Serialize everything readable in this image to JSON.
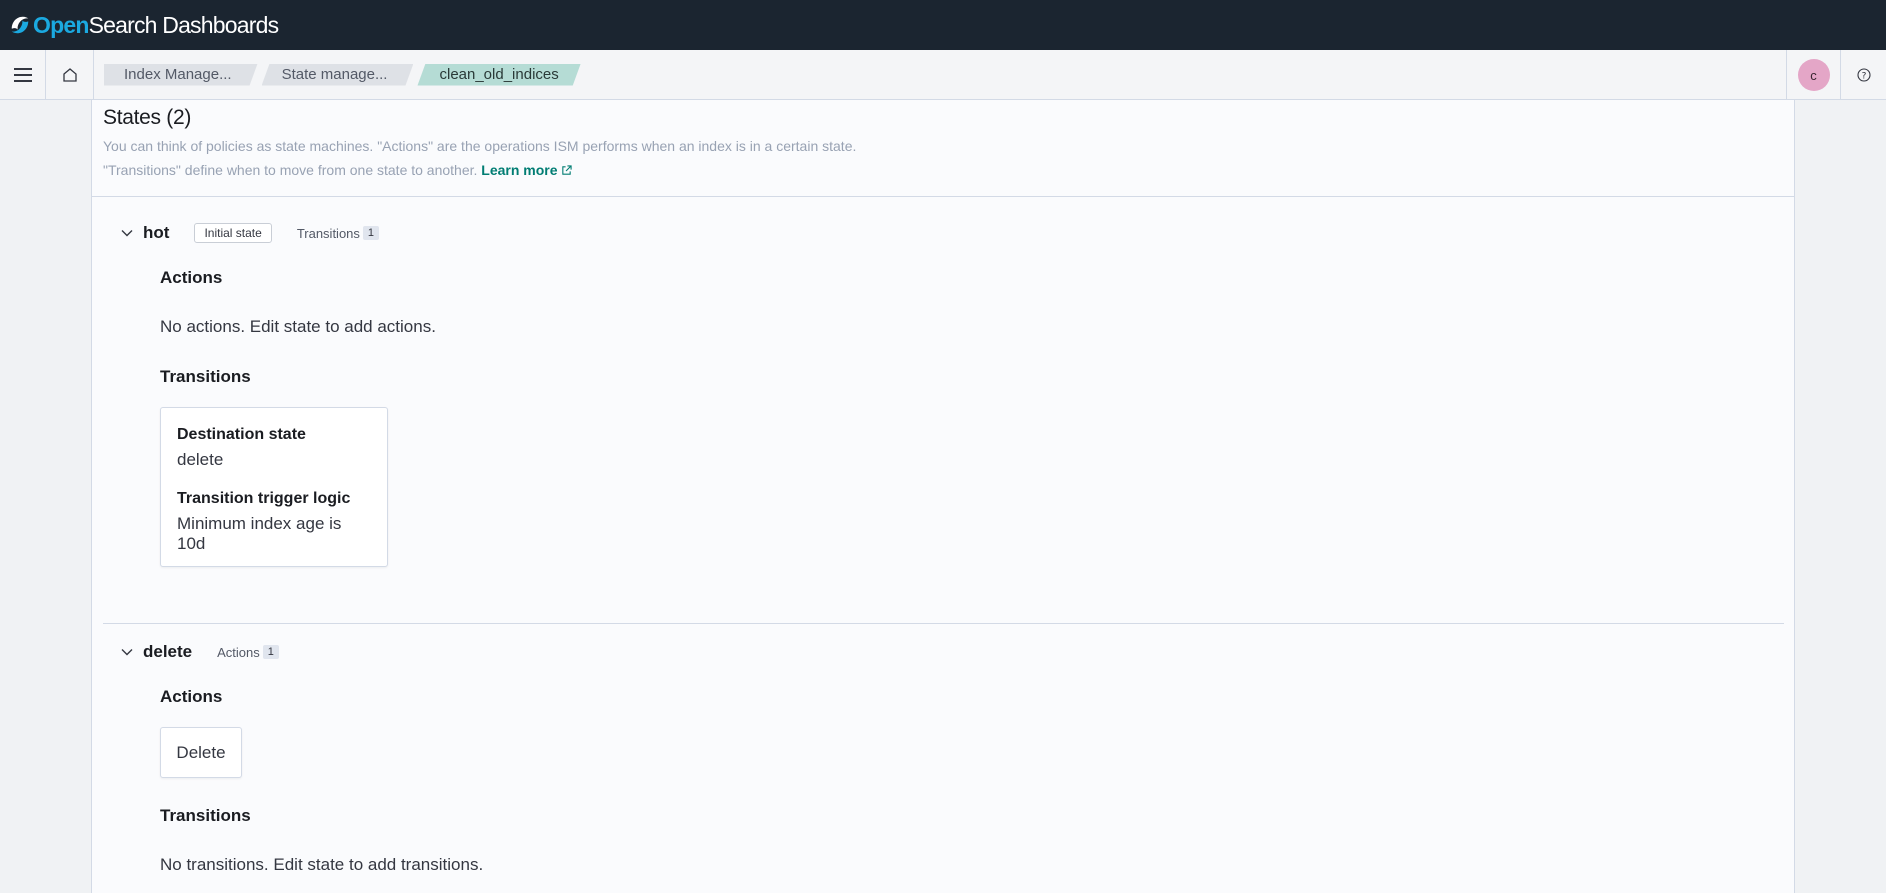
{
  "header": {
    "logo_open": "Open",
    "logo_rest": "Search Dashboards",
    "logo_icon": "opensearch-logo-icon"
  },
  "nav": {
    "menu_icon": "hamburger-menu-icon",
    "home_icon": "home-icon",
    "breadcrumbs": [
      {
        "label": "Index Manage..."
      },
      {
        "label": "State manage..."
      },
      {
        "label": "clean_old_indices"
      }
    ],
    "avatar_initial": "c",
    "help_icon": "help-icon"
  },
  "states_panel": {
    "title": "States (2)",
    "description_line1": "You can think of policies as state machines. \"Actions\" are the operations ISM performs when an index is in a certain state.",
    "description_line2": "\"Transitions\" define when to move from one state to another.",
    "learn_more": "Learn more",
    "states": [
      {
        "name": "hot",
        "initial_badge": "Initial state",
        "meta_label": "Transitions",
        "meta_count": "1",
        "actions_title": "Actions",
        "actions_empty": "No actions. Edit state to add actions.",
        "transitions_title": "Transitions",
        "transition_card": {
          "dest_label": "Destination state",
          "dest_value": "delete",
          "trigger_label": "Transition trigger logic",
          "trigger_value": "Minimum index age is 10d"
        }
      },
      {
        "name": "delete",
        "meta_label": "Actions",
        "meta_count": "1",
        "actions_title": "Actions",
        "action_card": "Delete",
        "transitions_title": "Transitions",
        "transitions_empty": "No transitions. Edit state to add transitions."
      }
    ]
  }
}
